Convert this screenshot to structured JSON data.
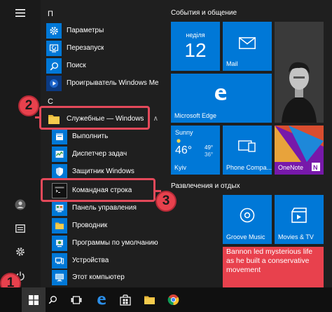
{
  "applist": {
    "letter_p": "П",
    "letter_s": "С",
    "items": [
      {
        "label": "Параметры"
      },
      {
        "label": "Перезапуск"
      },
      {
        "label": "Поиск"
      },
      {
        "label": "Проигрыватель Windows Media"
      },
      {
        "label": "Служебные — Windows"
      },
      {
        "label": "Выполнить"
      },
      {
        "label": "Диспетчер задач"
      },
      {
        "label": "Защитник Windows"
      },
      {
        "label": "Командная строка"
      },
      {
        "label": "Панель управления"
      },
      {
        "label": "Проводник"
      },
      {
        "label": "Программы по умолчанию"
      },
      {
        "label": "Устройства"
      },
      {
        "label": "Этот компьютер"
      }
    ]
  },
  "tiles": {
    "group1_title": "События и общение",
    "group2_title": "Развлечения и отдых",
    "calendar": {
      "day": "неділя",
      "date": "12"
    },
    "mail": {
      "label": "Mail"
    },
    "edge": {
      "label": "Microsoft Edge"
    },
    "weather": {
      "condition": "Sunny",
      "temp": "46°",
      "high": "49°",
      "low": "36°",
      "city": "Kyiv"
    },
    "phone": {
      "label": "Phone Compa..."
    },
    "onenote": {
      "label": "OneNote"
    },
    "groove": {
      "label": "Groove Music"
    },
    "movies": {
      "label": "Movies & TV"
    },
    "news": {
      "headline": "Bannon led mysterious life as he built a conservative movement"
    }
  },
  "markers": {
    "one": "1",
    "two": "2",
    "three": "3"
  },
  "colors": {
    "accent": "#0078d7",
    "marker": "#e8414d",
    "news": "#e8414d",
    "onenote": "#7719aa"
  }
}
